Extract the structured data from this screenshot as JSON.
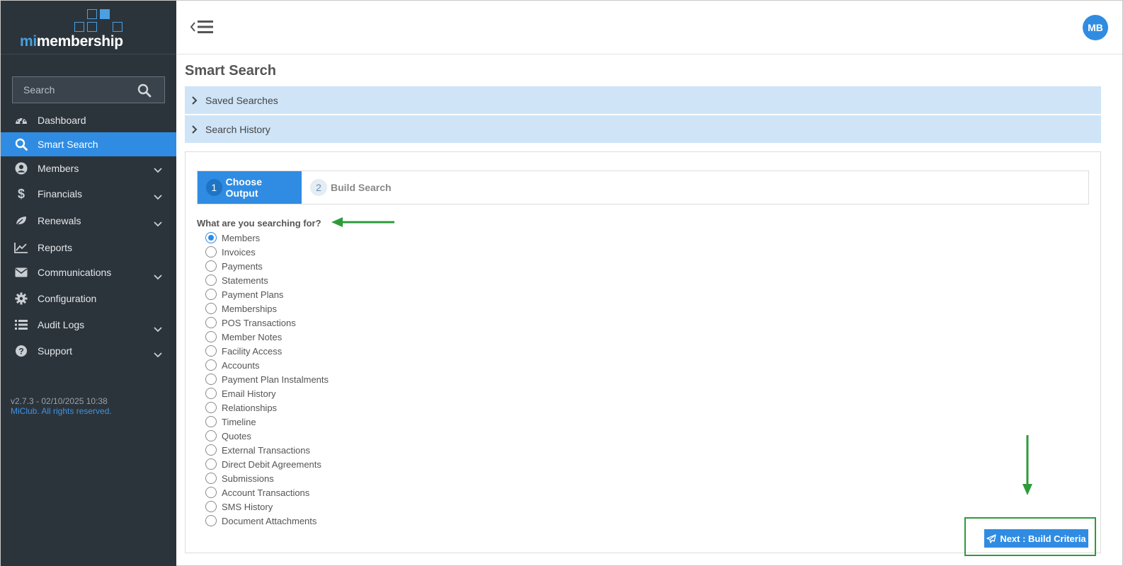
{
  "brand": {
    "prefix": "mi",
    "name": "membership"
  },
  "sidebar": {
    "search_placeholder": "Search",
    "items": [
      {
        "label": "Dashboard",
        "icon": "dashboard-icon",
        "active": false,
        "expandable": false
      },
      {
        "label": "Smart Search",
        "icon": "search-icon",
        "active": true,
        "expandable": false
      },
      {
        "label": "Members",
        "icon": "user-circle-icon",
        "active": false,
        "expandable": true
      },
      {
        "label": "Financials",
        "icon": "dollar-icon",
        "active": false,
        "expandable": true
      },
      {
        "label": "Renewals",
        "icon": "leaf-icon",
        "active": false,
        "expandable": true
      },
      {
        "label": "Reports",
        "icon": "line-chart-icon",
        "active": false,
        "expandable": false
      },
      {
        "label": "Communications",
        "icon": "envelope-icon",
        "active": false,
        "expandable": true
      },
      {
        "label": "Configuration",
        "icon": "gear-icon",
        "active": false,
        "expandable": false
      },
      {
        "label": "Audit Logs",
        "icon": "list-icon",
        "active": false,
        "expandable": true
      },
      {
        "label": "Support",
        "icon": "question-circle-icon",
        "active": false,
        "expandable": true
      }
    ],
    "version": "v2.7.3 - 02/10/2025 10:38",
    "copyright": "MiClub. All rights reserved."
  },
  "header": {
    "avatar_initials": "MB"
  },
  "main": {
    "title": "Smart Search",
    "accordions": [
      {
        "label": "Saved Searches"
      },
      {
        "label": "Search History"
      }
    ],
    "steps": [
      {
        "number": "1",
        "label": "Choose Output",
        "active": true
      },
      {
        "number": "2",
        "label": "Build Search",
        "active": false
      }
    ],
    "question": "What are you searching for?",
    "selected_option": "Members",
    "options": [
      "Members",
      "Invoices",
      "Payments",
      "Statements",
      "Payment Plans",
      "Memberships",
      "POS Transactions",
      "Member Notes",
      "Facility Access",
      "Accounts",
      "Payment Plan Instalments",
      "Email History",
      "Relationships",
      "Timeline",
      "Quotes",
      "External Transactions",
      "Direct Debit Agreements",
      "Submissions",
      "Account Transactions",
      "SMS History",
      "Document Attachments"
    ],
    "next_button_label": "Next : Build Criteria"
  },
  "colors": {
    "sidebar_bg": "#2c343b",
    "accent": "#2f8ce2",
    "accordion_bg": "#cfe4f7",
    "annotation": "#2e9b3a"
  }
}
